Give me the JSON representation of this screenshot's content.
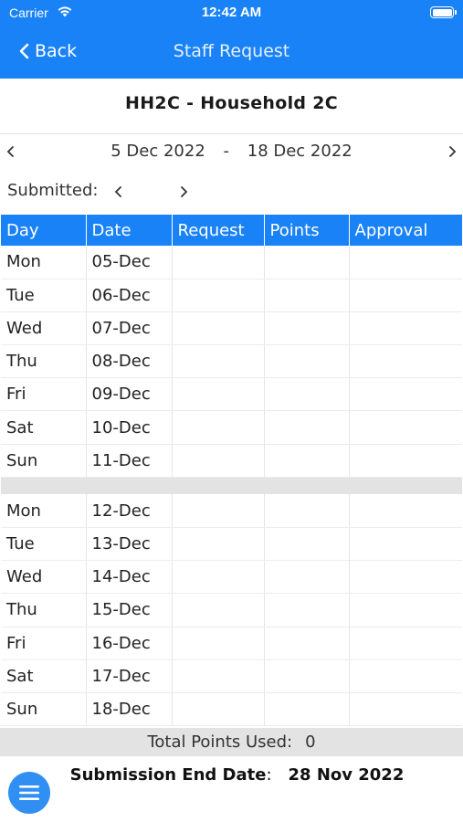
{
  "status_bar": {
    "carrier": "Carrier",
    "time": "12:42 AM"
  },
  "nav": {
    "back_label": "Back",
    "title": "Staff Request"
  },
  "unit_title": "HH2C - Household 2C",
  "date_range": {
    "start": "5 Dec 2022",
    "separator": "-",
    "end": "18 Dec 2022"
  },
  "submitted_label": "Submitted:",
  "table": {
    "headers": [
      "Day",
      "Date",
      "Request",
      "Points",
      "Approval"
    ],
    "week1": [
      {
        "day": "Mon",
        "date": "05-Dec"
      },
      {
        "day": "Tue",
        "date": "06-Dec"
      },
      {
        "day": "Wed",
        "date": "07-Dec"
      },
      {
        "day": "Thu",
        "date": "08-Dec"
      },
      {
        "day": "Fri",
        "date": "09-Dec"
      },
      {
        "day": "Sat",
        "date": "10-Dec"
      },
      {
        "day": "Sun",
        "date": "11-Dec"
      }
    ],
    "week2": [
      {
        "day": "Mon",
        "date": "12-Dec"
      },
      {
        "day": "Tue",
        "date": "13-Dec"
      },
      {
        "day": "Wed",
        "date": "14-Dec"
      },
      {
        "day": "Thu",
        "date": "15-Dec"
      },
      {
        "day": "Fri",
        "date": "16-Dec"
      },
      {
        "day": "Sat",
        "date": "17-Dec"
      },
      {
        "day": "Sun",
        "date": "18-Dec"
      }
    ]
  },
  "total_points": {
    "label": "Total Points Used:",
    "value": "0"
  },
  "submission_end": {
    "label": "Submission End Date",
    "colon": ":",
    "value": "28 Nov 2022"
  },
  "icons": {
    "back": "chevron-left-icon",
    "menu": "hamburger-menu-icon",
    "wifi": "wifi-icon",
    "battery": "battery-icon"
  },
  "colors": {
    "accent": "#1a82f7",
    "band": "#e3e3e3"
  }
}
